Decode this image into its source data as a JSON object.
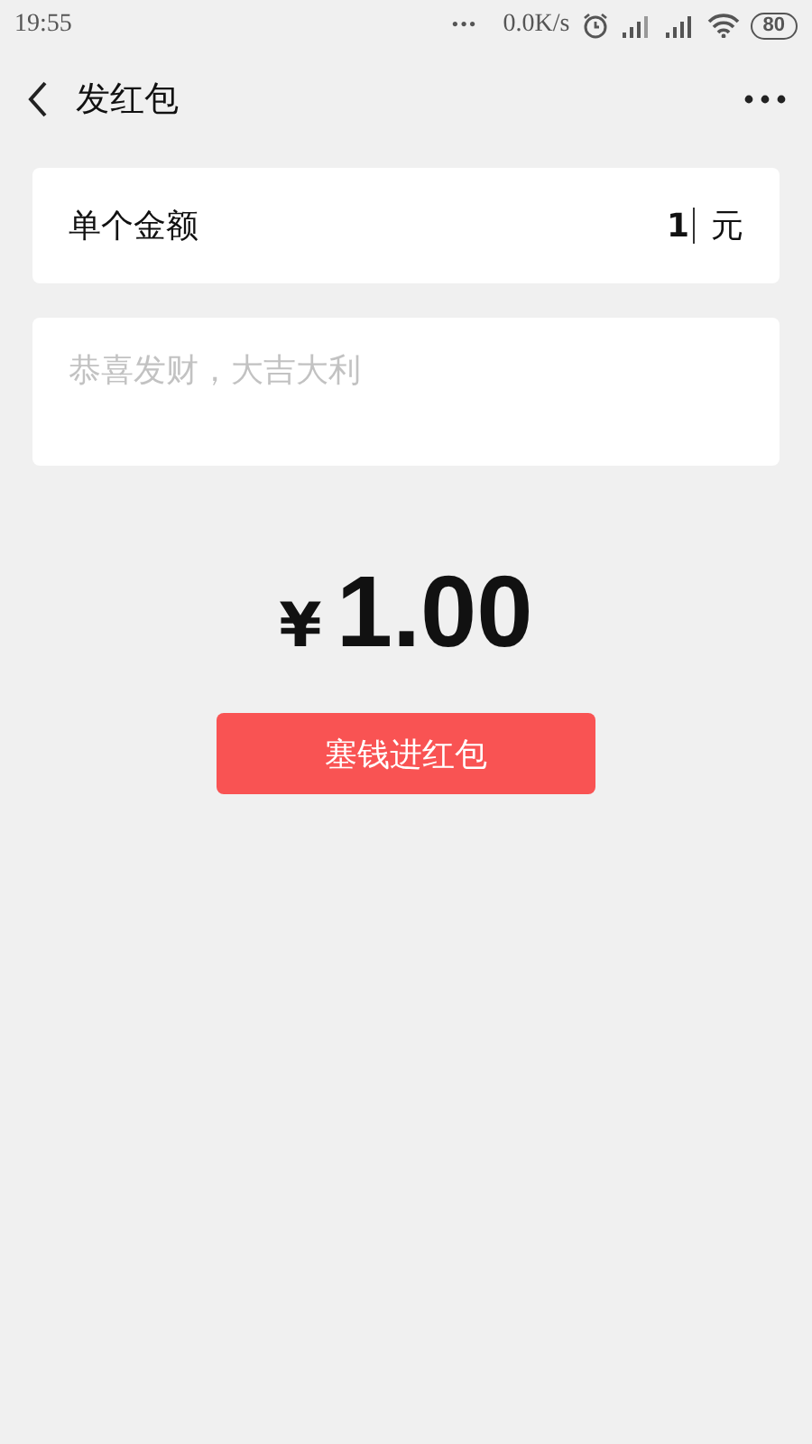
{
  "status_bar": {
    "time": "19:55",
    "dots": "•••",
    "speed": "0.0K/s",
    "battery": "80"
  },
  "header": {
    "title": "发红包"
  },
  "amount_field": {
    "label": "单个金额",
    "value": "1",
    "unit": "元"
  },
  "greeting_field": {
    "placeholder": "恭喜发财，大吉大利"
  },
  "total": {
    "currency": "¥",
    "amount": "1.00"
  },
  "submit_button": {
    "label": "塞钱进红包"
  }
}
